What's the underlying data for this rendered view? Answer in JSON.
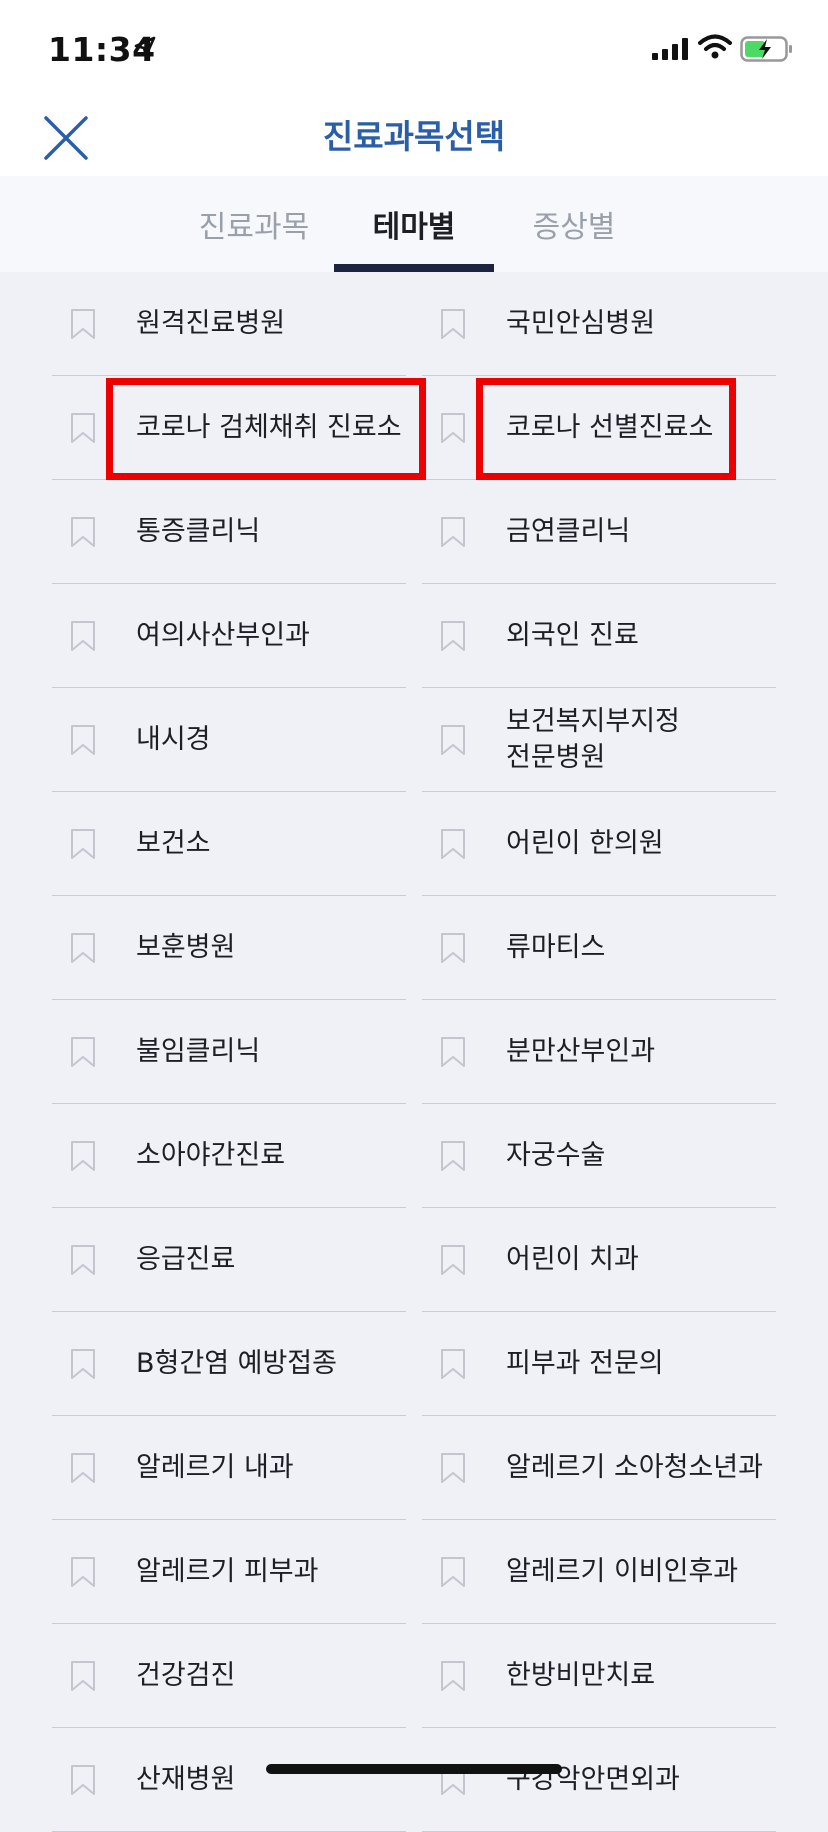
{
  "status_bar": {
    "time": "11:34",
    "icons": [
      "location-arrow-icon",
      "signal-icon",
      "wifi-icon",
      "battery-charging-icon"
    ]
  },
  "header": {
    "title": "진료과목선택",
    "close_icon": "close-icon"
  },
  "tabs": [
    {
      "label": "진료과목",
      "active": false
    },
    {
      "label": "테마별",
      "active": true
    },
    {
      "label": "증상별",
      "active": false
    }
  ],
  "rows": [
    {
      "left": "원격진료병원",
      "right": "국민안심병원"
    },
    {
      "left": "코로나 검체채취 진료소",
      "right": "코로나 선별진료소"
    },
    {
      "left": "통증클리닉",
      "right": "금연클리닉"
    },
    {
      "left": "여의사산부인과",
      "right": "외국인 진료"
    },
    {
      "left": "내시경",
      "right": "보건복지부지정\n전문병원"
    },
    {
      "left": "보건소",
      "right": "어린이 한의원"
    },
    {
      "left": "보훈병원",
      "right": "류마티스"
    },
    {
      "left": "불임클리닉",
      "right": "분만산부인과"
    },
    {
      "left": "소아야간진료",
      "right": "자궁수술"
    },
    {
      "left": "응급진료",
      "right": "어린이 치과"
    },
    {
      "left": "B형간염 예방접종",
      "right": "피부과 전문의"
    },
    {
      "left": "알레르기 내과",
      "right": "알레르기 소아청소년과"
    },
    {
      "left": "알레르기 피부과",
      "right": "알레르기 이비인후과"
    },
    {
      "left": "건강검진",
      "right": "한방비만치료"
    },
    {
      "left": "산재병원",
      "right": "구강악안면외과"
    }
  ],
  "bookmark_icon": "bookmark-outline-icon",
  "colors": {
    "title": "#2a5ea8",
    "tab_underline": "#1d2440",
    "highlight": "#ee0000",
    "list_background": "#eff1f7"
  }
}
